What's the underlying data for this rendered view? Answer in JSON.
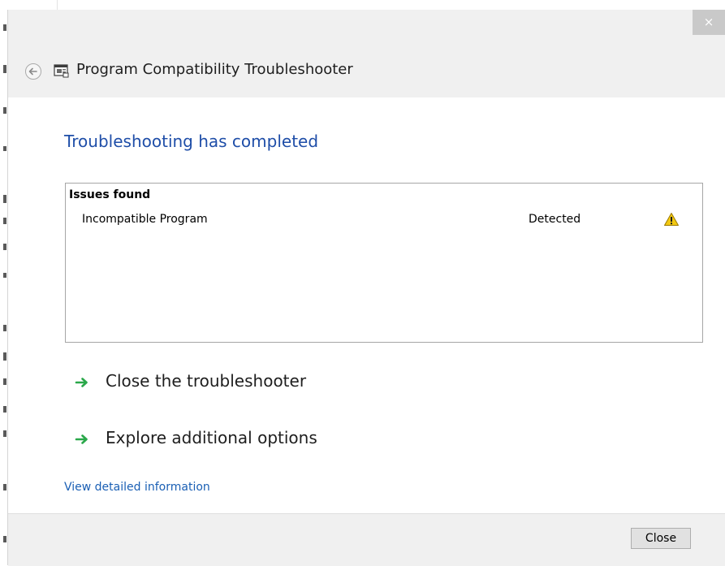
{
  "window": {
    "title": "Program Compatibility Troubleshooter",
    "close_glyph": "×"
  },
  "icons": {
    "back": "back-arrow-icon",
    "app": "troubleshooter-app-icon",
    "warning": "warning-icon",
    "command_arrow": "green-arrow-icon"
  },
  "main": {
    "heading": "Troubleshooting has completed",
    "issues": {
      "header": "Issues found",
      "rows": [
        {
          "name": "Incompatible Program",
          "status": "Detected",
          "severity_icon": "warning-icon"
        }
      ]
    },
    "commands": [
      {
        "label": "Close the troubleshooter"
      },
      {
        "label": "Explore additional options"
      }
    ],
    "detail_link": "View detailed information"
  },
  "footer": {
    "close_label": "Close"
  },
  "colors": {
    "heading": "#1f4ea8",
    "link": "#1a5fb4",
    "header_bg": "#f0f0f0",
    "footer_bg": "#f0f0f0",
    "arrow": "#2aa84a",
    "warning": "#f2c811"
  }
}
